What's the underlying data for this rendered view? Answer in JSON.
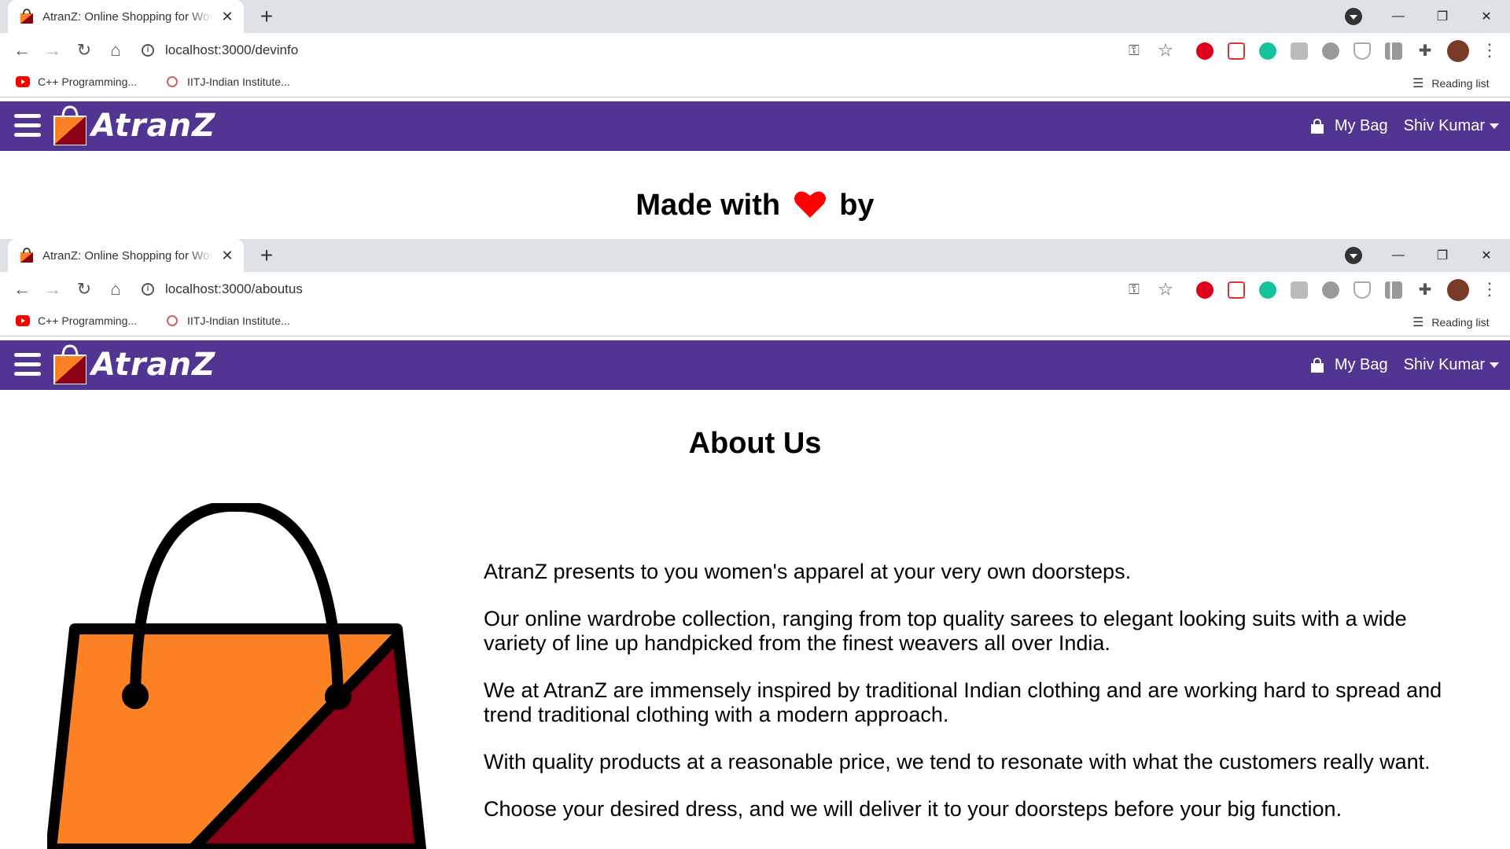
{
  "windows": [
    {
      "tab_title": "AtranZ: Online Shopping for Women",
      "url": "localhost:3000/devinfo"
    },
    {
      "tab_title": "AtranZ: Online Shopping for Women",
      "url": "localhost:3000/aboutus"
    }
  ],
  "bookmarks": {
    "item1": "C++ Programming...",
    "item2": "IITJ-Indian Institute...",
    "reading_list": "Reading list"
  },
  "navbar": {
    "logo_text": "AtranZ",
    "bag_label": "My Bag",
    "user_label": "Shiv Kumar"
  },
  "devinfo": {
    "made_with": "Made with",
    "by": "by"
  },
  "about": {
    "title": "About Us",
    "paragraphs": [
      "AtranZ presents to you women's apparel at your very own doorsteps.",
      "Our online wardrobe collection, ranging from top quality sarees to elegant looking suits with a wide variety of line up handpicked from the finest weavers all over India.",
      "We at AtranZ are immensely inspired by traditional Indian clothing and are working hard to spread and trend traditional clothing with a modern approach.",
      "With quality products at a reasonable price, we tend to resonate with what the customers really want.",
      "Choose your desired dress, and we will deliver it to your doorsteps before your big function."
    ]
  },
  "colors": {
    "navbar": "#523593",
    "bag_orange": "#fc8122",
    "bag_maroon": "#8b0015",
    "heart": "#ff0000"
  }
}
